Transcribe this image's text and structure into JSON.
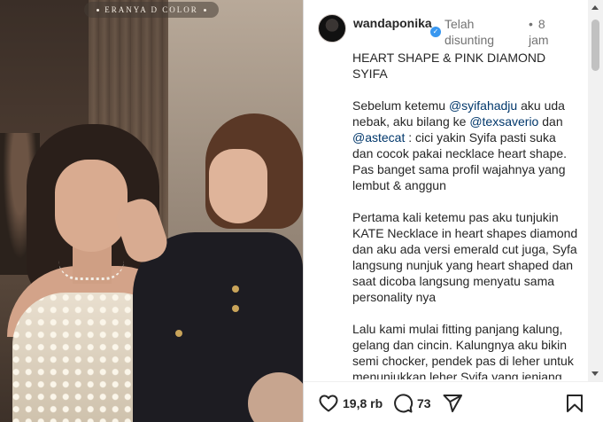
{
  "photo": {
    "brand_text": "ERANYA D COLOR"
  },
  "header": {
    "username": "wandaponika",
    "verified_icon": "verified-badge-icon",
    "edited_label": "Telah disunting",
    "time_separator": "•",
    "time": "8 jam"
  },
  "caption": {
    "title": "HEART SHAPE & PINK DIAMOND SYIFA",
    "para1": {
      "t1": "Sebelum ketemu ",
      "m1": "@syifahadju",
      "t2": " aku uda nebak, aku bilang ke ",
      "m2": "@texsaverio",
      "t3": " dan ",
      "m3": "@astecat",
      "t4": " : cici yakin Syifa pasti suka dan cocok pakai necklace heart shape. Pas banget sama profil wajahnya yang lembut & anggun"
    },
    "para2": "Pertama kali ketemu pas aku tunjukin KATE Necklace in heart shapes diamond dan aku ada versi emerald cut juga, Syfa langsung nunjuk yang heart shaped dan saat dicoba langsung menyatu sama personality nya",
    "para3": "Lalu kami mulai fitting panjang kalung, gelang dan cincin. Kalungnya aku bikin semi chocker, pendek pas di leher untuk menunjukkan leher Syifa yang jenjang"
  },
  "actions": {
    "like_count": "19,8 rb",
    "comment_count": "73",
    "icons": [
      "heart-icon",
      "comment-icon",
      "share-icon",
      "bookmark-icon"
    ]
  },
  "colors": {
    "mention": "#00376b",
    "verified": "#3897f0",
    "secondary_text": "#737373"
  }
}
